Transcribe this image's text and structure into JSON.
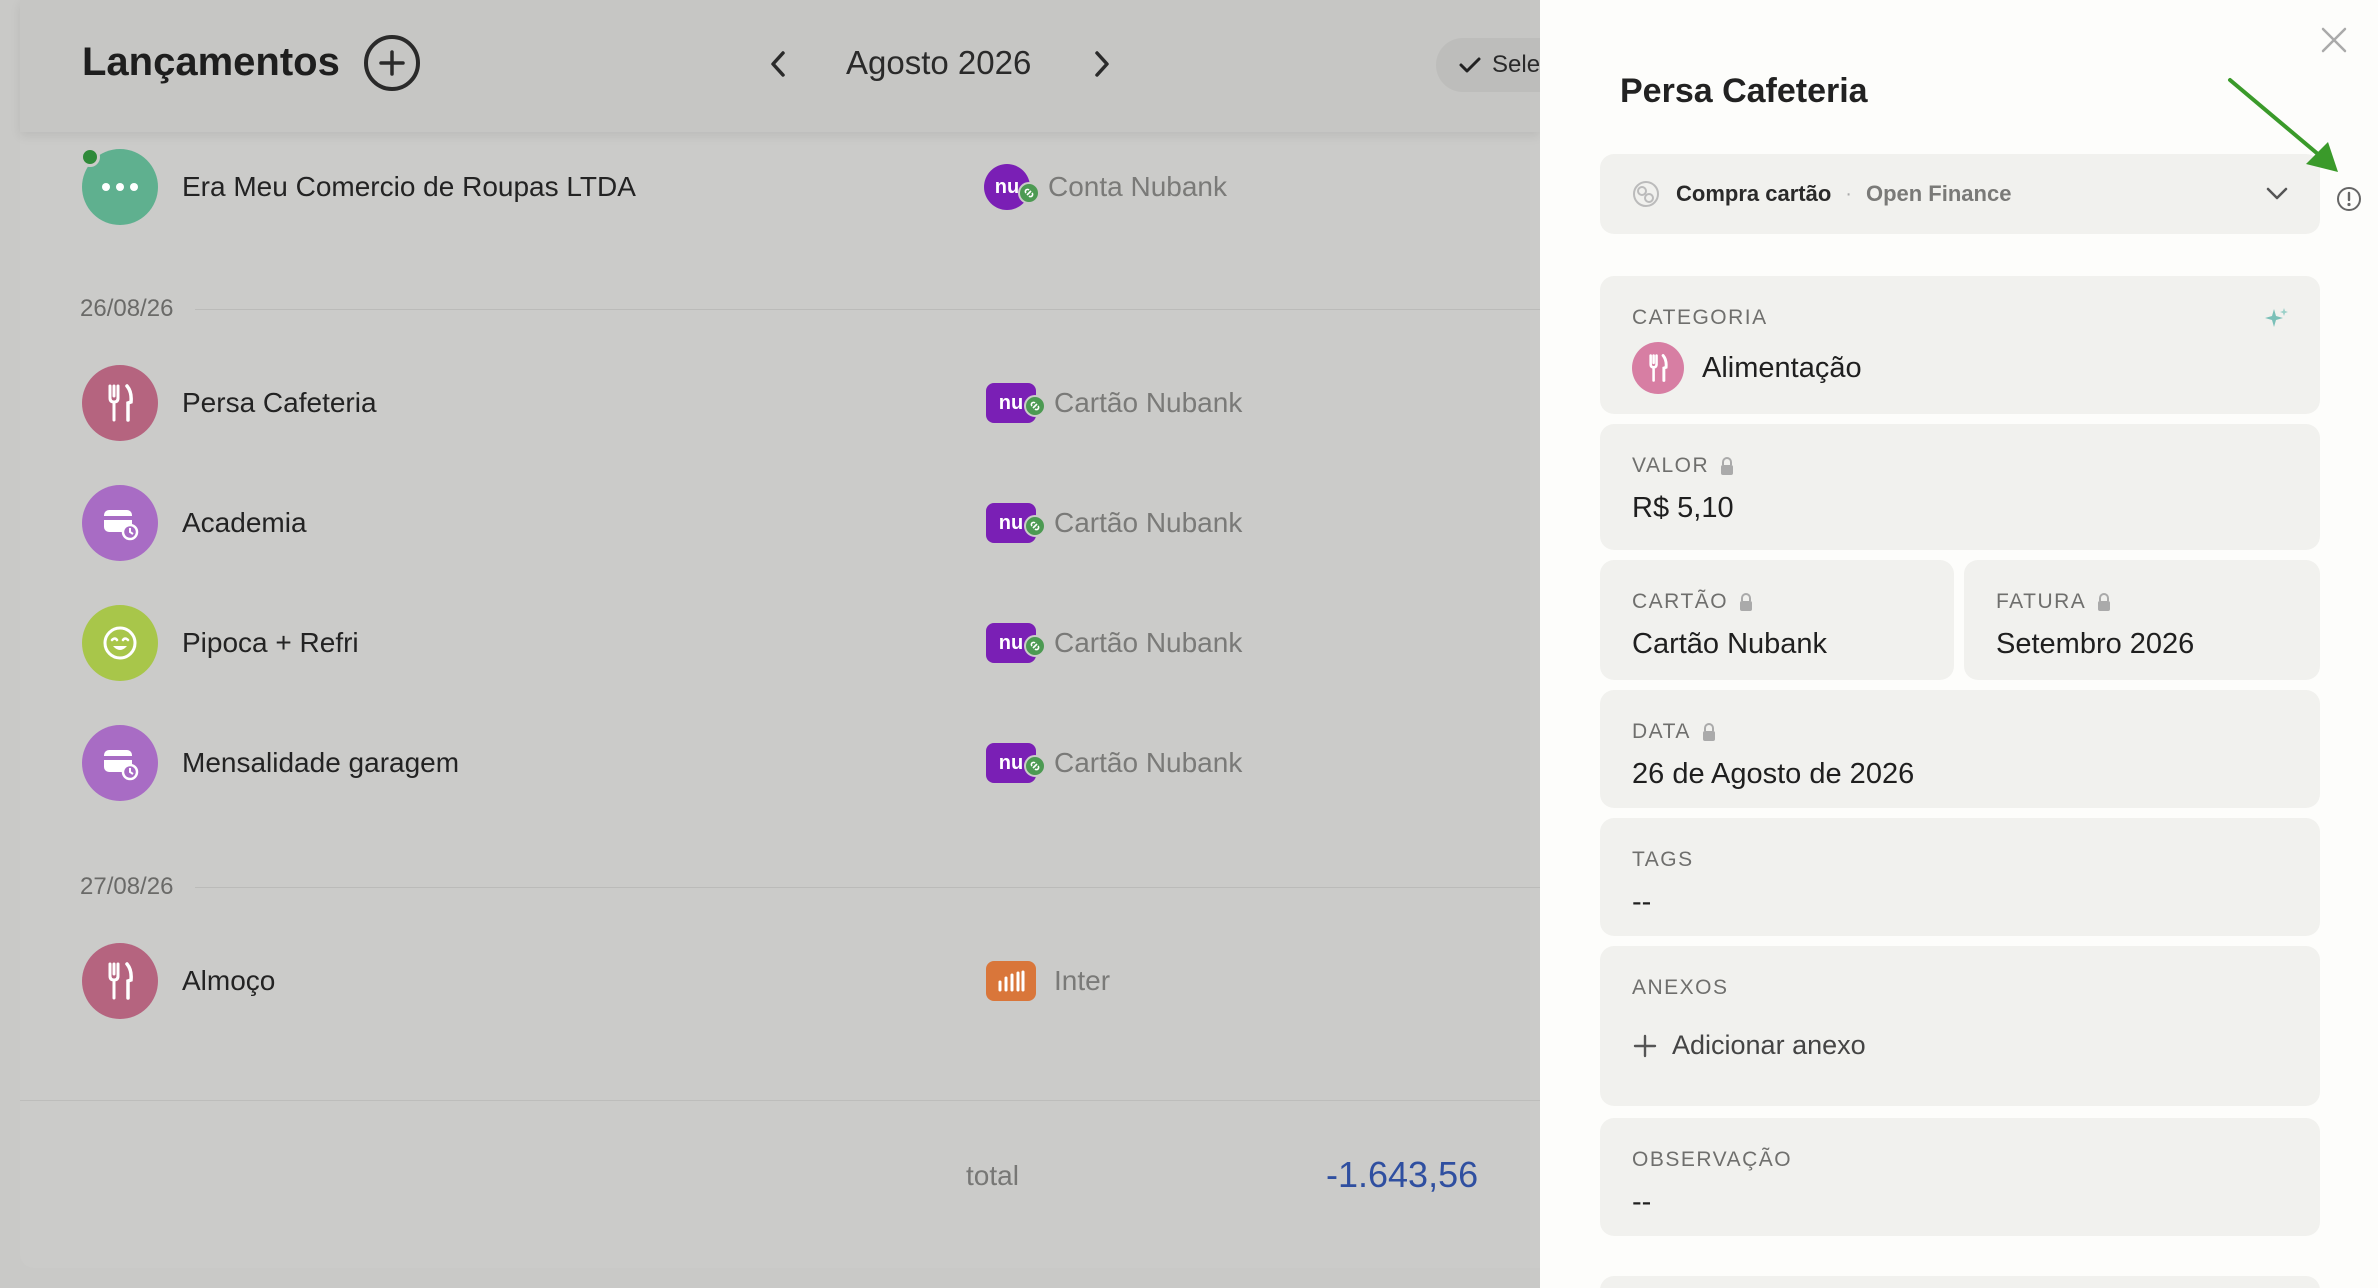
{
  "header": {
    "title": "Lançamentos",
    "month": "Agosto 2026",
    "select_label": "Sele"
  },
  "list": {
    "first_item": {
      "name": "Era Meu Comercio de Roupas LTDA",
      "account": "Conta Nubank"
    },
    "groups": [
      {
        "date": "26/08/26",
        "items": [
          {
            "name": "Persa Cafeteria",
            "account": "Cartão Nubank"
          },
          {
            "name": "Academia",
            "account": "Cartão Nubank"
          },
          {
            "name": "Pipoca + Refri",
            "account": "Cartão Nubank"
          },
          {
            "name": "Mensalidade garagem",
            "account": "Cartão Nubank"
          }
        ]
      },
      {
        "date": "27/08/26",
        "items": [
          {
            "name": "Almoço",
            "account": "Inter"
          }
        ]
      }
    ],
    "total_label": "total",
    "total_value": "-1.643,56"
  },
  "logos": {
    "nubank": "nu"
  },
  "detail": {
    "title": "Persa Cafeteria",
    "type_main": "Compra cartão",
    "type_separator": "·",
    "type_sub": "Open Finance",
    "categoria_label": "CATEGORIA",
    "categoria_value": "Alimentação",
    "valor_label": "VALOR",
    "valor_value": "R$ 5,10",
    "cartao_label": "CARTÃO",
    "cartao_value": "Cartão Nubank",
    "fatura_label": "FATURA",
    "fatura_value": "Setembro 2026",
    "data_label": "DATA",
    "data_value": "26 de Agosto de 2026",
    "tags_label": "TAGS",
    "tags_value": "--",
    "anexos_label": "ANEXOS",
    "anexos_add": "Adicionar anexo",
    "obs_label": "OBSERVAÇÃO",
    "obs_value": "--"
  },
  "colors": {
    "nubank": "#7a1fb5",
    "inter": "#d9763a",
    "alimentacao": "#b5647f",
    "servicos": "#a86cc4",
    "lazer": "#a8c64a",
    "outros": "#5fb08f",
    "total": "#2f4fa0",
    "annotation_arrow": "#3a9a2a"
  }
}
